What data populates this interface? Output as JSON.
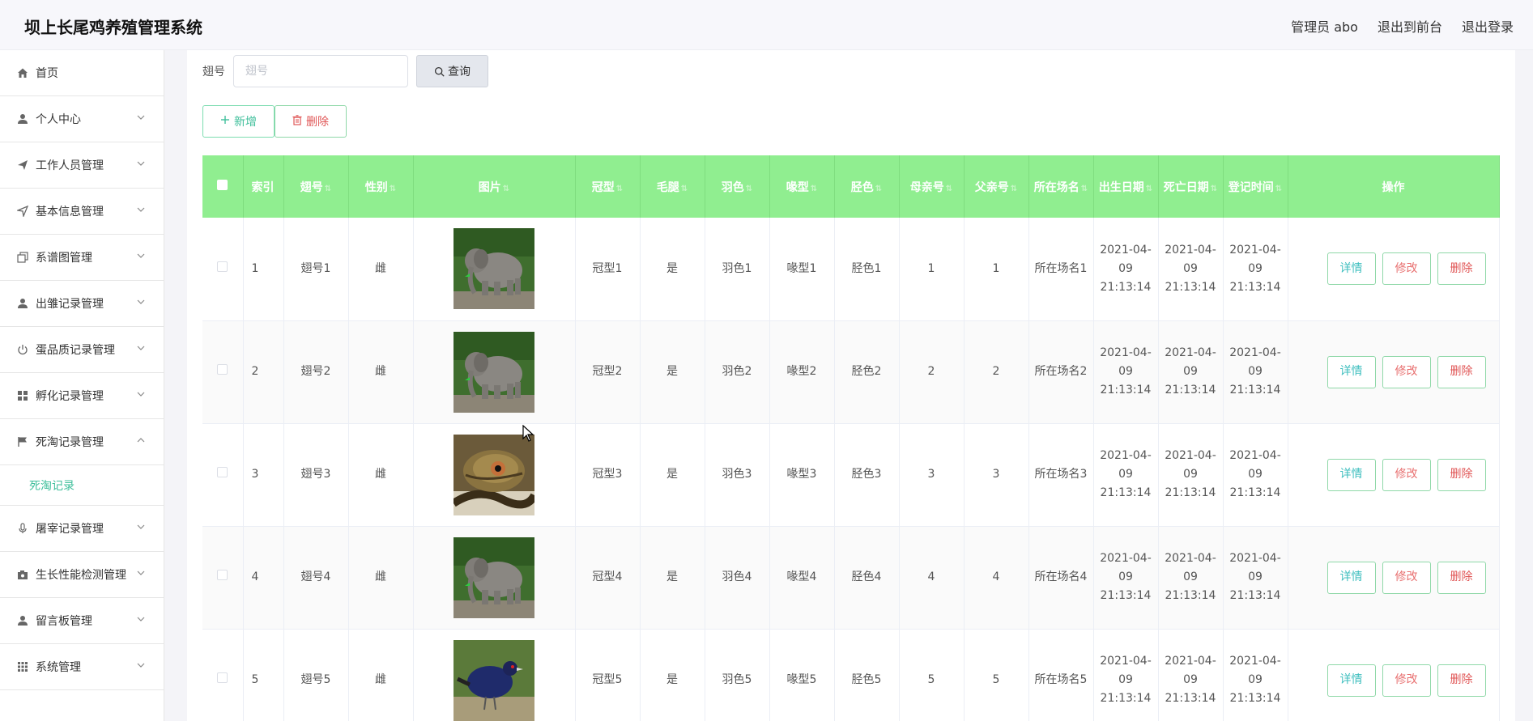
{
  "app": {
    "title": "坝上长尾鸡养殖管理系统"
  },
  "header": {
    "user": "管理员 abo",
    "front": "退出到前台",
    "logout": "退出登录"
  },
  "sidebar": {
    "items": [
      {
        "label": "首页",
        "icon": "home-icon"
      },
      {
        "label": "个人中心",
        "icon": "user-icon"
      },
      {
        "label": "工作人员管理",
        "icon": "send-icon"
      },
      {
        "label": "基本信息管理",
        "icon": "navigation-icon"
      },
      {
        "label": "系谱图管理",
        "icon": "copy-icon"
      },
      {
        "label": "出雏记录管理",
        "icon": "user-icon"
      },
      {
        "label": "蛋品质记录管理",
        "icon": "power-icon"
      },
      {
        "label": "孵化记录管理",
        "icon": "grid-icon"
      },
      {
        "label": "死淘记录管理",
        "icon": "flag-icon"
      },
      {
        "label": "屠宰记录管理",
        "icon": "mic-icon"
      },
      {
        "label": "生长性能检测管理",
        "icon": "camera-icon"
      },
      {
        "label": "留言板管理",
        "icon": "user-icon"
      },
      {
        "label": "系统管理",
        "icon": "apps-icon"
      }
    ],
    "sub_item": "死淘记录"
  },
  "search": {
    "label": "翅号",
    "placeholder": "翅号",
    "value": "",
    "button": "查询"
  },
  "actions": {
    "add": "新增",
    "delete": "删除"
  },
  "table": {
    "headers": [
      "索引",
      "翅号",
      "性别",
      "图片",
      "冠型",
      "毛腿",
      "羽色",
      "喙型",
      "胫色",
      "母亲号",
      "父亲号",
      "所在场名",
      "出生日期",
      "死亡日期",
      "登记时间",
      "操作"
    ],
    "row_actions": {
      "detail": "详情",
      "edit": "修改",
      "delete": "删除"
    },
    "rows": [
      {
        "index": "1",
        "wing": "翅号1",
        "sex": "雌",
        "image": "elephant",
        "comb": "冠型1",
        "legs": "是",
        "feather": "羽色1",
        "beak": "喙型1",
        "shank": "胫色1",
        "mother": "1",
        "father": "1",
        "farm": "所在场名1",
        "birth": "2021-04-09 21:13:14",
        "death": "2021-04-09 21:13:14",
        "reg": "2021-04-09 21:13:14"
      },
      {
        "index": "2",
        "wing": "翅号2",
        "sex": "雌",
        "image": "elephant",
        "comb": "冠型2",
        "legs": "是",
        "feather": "羽色2",
        "beak": "喙型2",
        "shank": "胫色2",
        "mother": "2",
        "father": "2",
        "farm": "所在场名2",
        "birth": "2021-04-09 21:13:14",
        "death": "2021-04-09 21:13:14",
        "reg": "2021-04-09 21:13:14"
      },
      {
        "index": "3",
        "wing": "翅号3",
        "sex": "雌",
        "image": "snake",
        "comb": "冠型3",
        "legs": "是",
        "feather": "羽色3",
        "beak": "喙型3",
        "shank": "胫色3",
        "mother": "3",
        "father": "3",
        "farm": "所在场名3",
        "birth": "2021-04-09 21:13:14",
        "death": "2021-04-09 21:13:14",
        "reg": "2021-04-09 21:13:14"
      },
      {
        "index": "4",
        "wing": "翅号4",
        "sex": "雌",
        "image": "elephant",
        "comb": "冠型4",
        "legs": "是",
        "feather": "羽色4",
        "beak": "喙型4",
        "shank": "胫色4",
        "mother": "4",
        "father": "4",
        "farm": "所在场名4",
        "birth": "2021-04-09 21:13:14",
        "death": "2021-04-09 21:13:14",
        "reg": "2021-04-09 21:13:14"
      },
      {
        "index": "5",
        "wing": "翅号5",
        "sex": "雌",
        "image": "pheasant",
        "comb": "冠型5",
        "legs": "是",
        "feather": "羽色5",
        "beak": "喙型5",
        "shank": "胫色5",
        "mother": "5",
        "father": "5",
        "farm": "所在场名5",
        "birth": "2021-04-09 21:13:14",
        "death": "2021-04-09 21:13:14",
        "reg": "2021-04-09 21:13:14"
      }
    ]
  },
  "colors": {
    "header_green": "#90ee90",
    "accent": "#3fbf9b",
    "danger": "#e05656"
  }
}
